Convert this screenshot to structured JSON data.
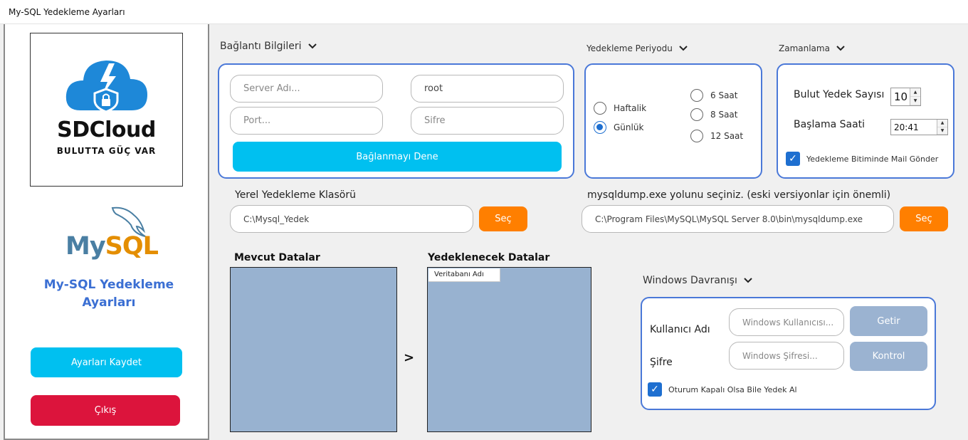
{
  "window": {
    "title": "My-SQL Yedekleme Ayarları"
  },
  "sidebar": {
    "brand": {
      "name": "SDCloud",
      "tagline": "BULUTTA GÜÇ VAR",
      "icon": "cloud-lightning-shield-icon"
    },
    "mysql_logo": {
      "text_my": "My",
      "text_sql": "SQL",
      "icon": "dolphin-icon"
    },
    "app_title": "My-SQL Yedekleme Ayarları",
    "save_label": "Ayarları Kaydet",
    "exit_label": "Çıkış"
  },
  "connection": {
    "label": "Bağlantı Bilgileri",
    "server_placeholder": "Server Adı...",
    "user_value": "root",
    "port_placeholder": "Port...",
    "password_placeholder": "Sifre",
    "test_label": "Bağlanmayı Dene"
  },
  "period": {
    "label": "Yedekleme Periyodu",
    "options": [
      "Haftalik",
      "Günlük",
      "6 Saat",
      "8 Saat",
      "12 Saat"
    ],
    "selected": "Günlük"
  },
  "schedule": {
    "label": "Zamanlama",
    "cloud_count_label": "Bulut Yedek Sayısı",
    "cloud_count_value": "10",
    "start_time_label": "Başlama Saati",
    "start_time_value": "20:41",
    "mail_label": "Yedekleme Bitiminde Mail Gönder",
    "mail_checked": true
  },
  "local_backup": {
    "label": "Yerel Yedekleme Klasörü",
    "path": "C:\\Mysql_Yedek",
    "select_label": "Seç"
  },
  "mysqldump": {
    "label": "mysqldump.exe yolunu seçiniz. (eski versiyonlar için önemli)",
    "path": "C:\\Program Files\\MySQL\\MySQL Server 8.0\\bin\\mysqldump.exe",
    "select_label": "Seç"
  },
  "data_lists": {
    "existing_label": "Mevcut Datalar",
    "backup_label": "Yedeklenecek Datalar",
    "move_label": ">",
    "backup_column_header": "Veritabanı Adı"
  },
  "windows_behavior": {
    "label": "Windows Davranışı",
    "username_label": "Kullanıcı Adı",
    "password_label": "Şifre",
    "username_placeholder": "Windows Kullanıcısı...",
    "password_placeholder": "Windows Şifresi...",
    "get_label": "Getir",
    "check_label": "Kontrol",
    "logged_off_label": "Oturum Kapalı Olsa Bile Yedek Al",
    "logged_off_checked": true
  },
  "colors": {
    "accent_blue": "#4a78d8",
    "cyan": "#00c0f0",
    "red": "#dc143c",
    "orange": "#ff7f00",
    "listbox": "#98b2d0"
  }
}
